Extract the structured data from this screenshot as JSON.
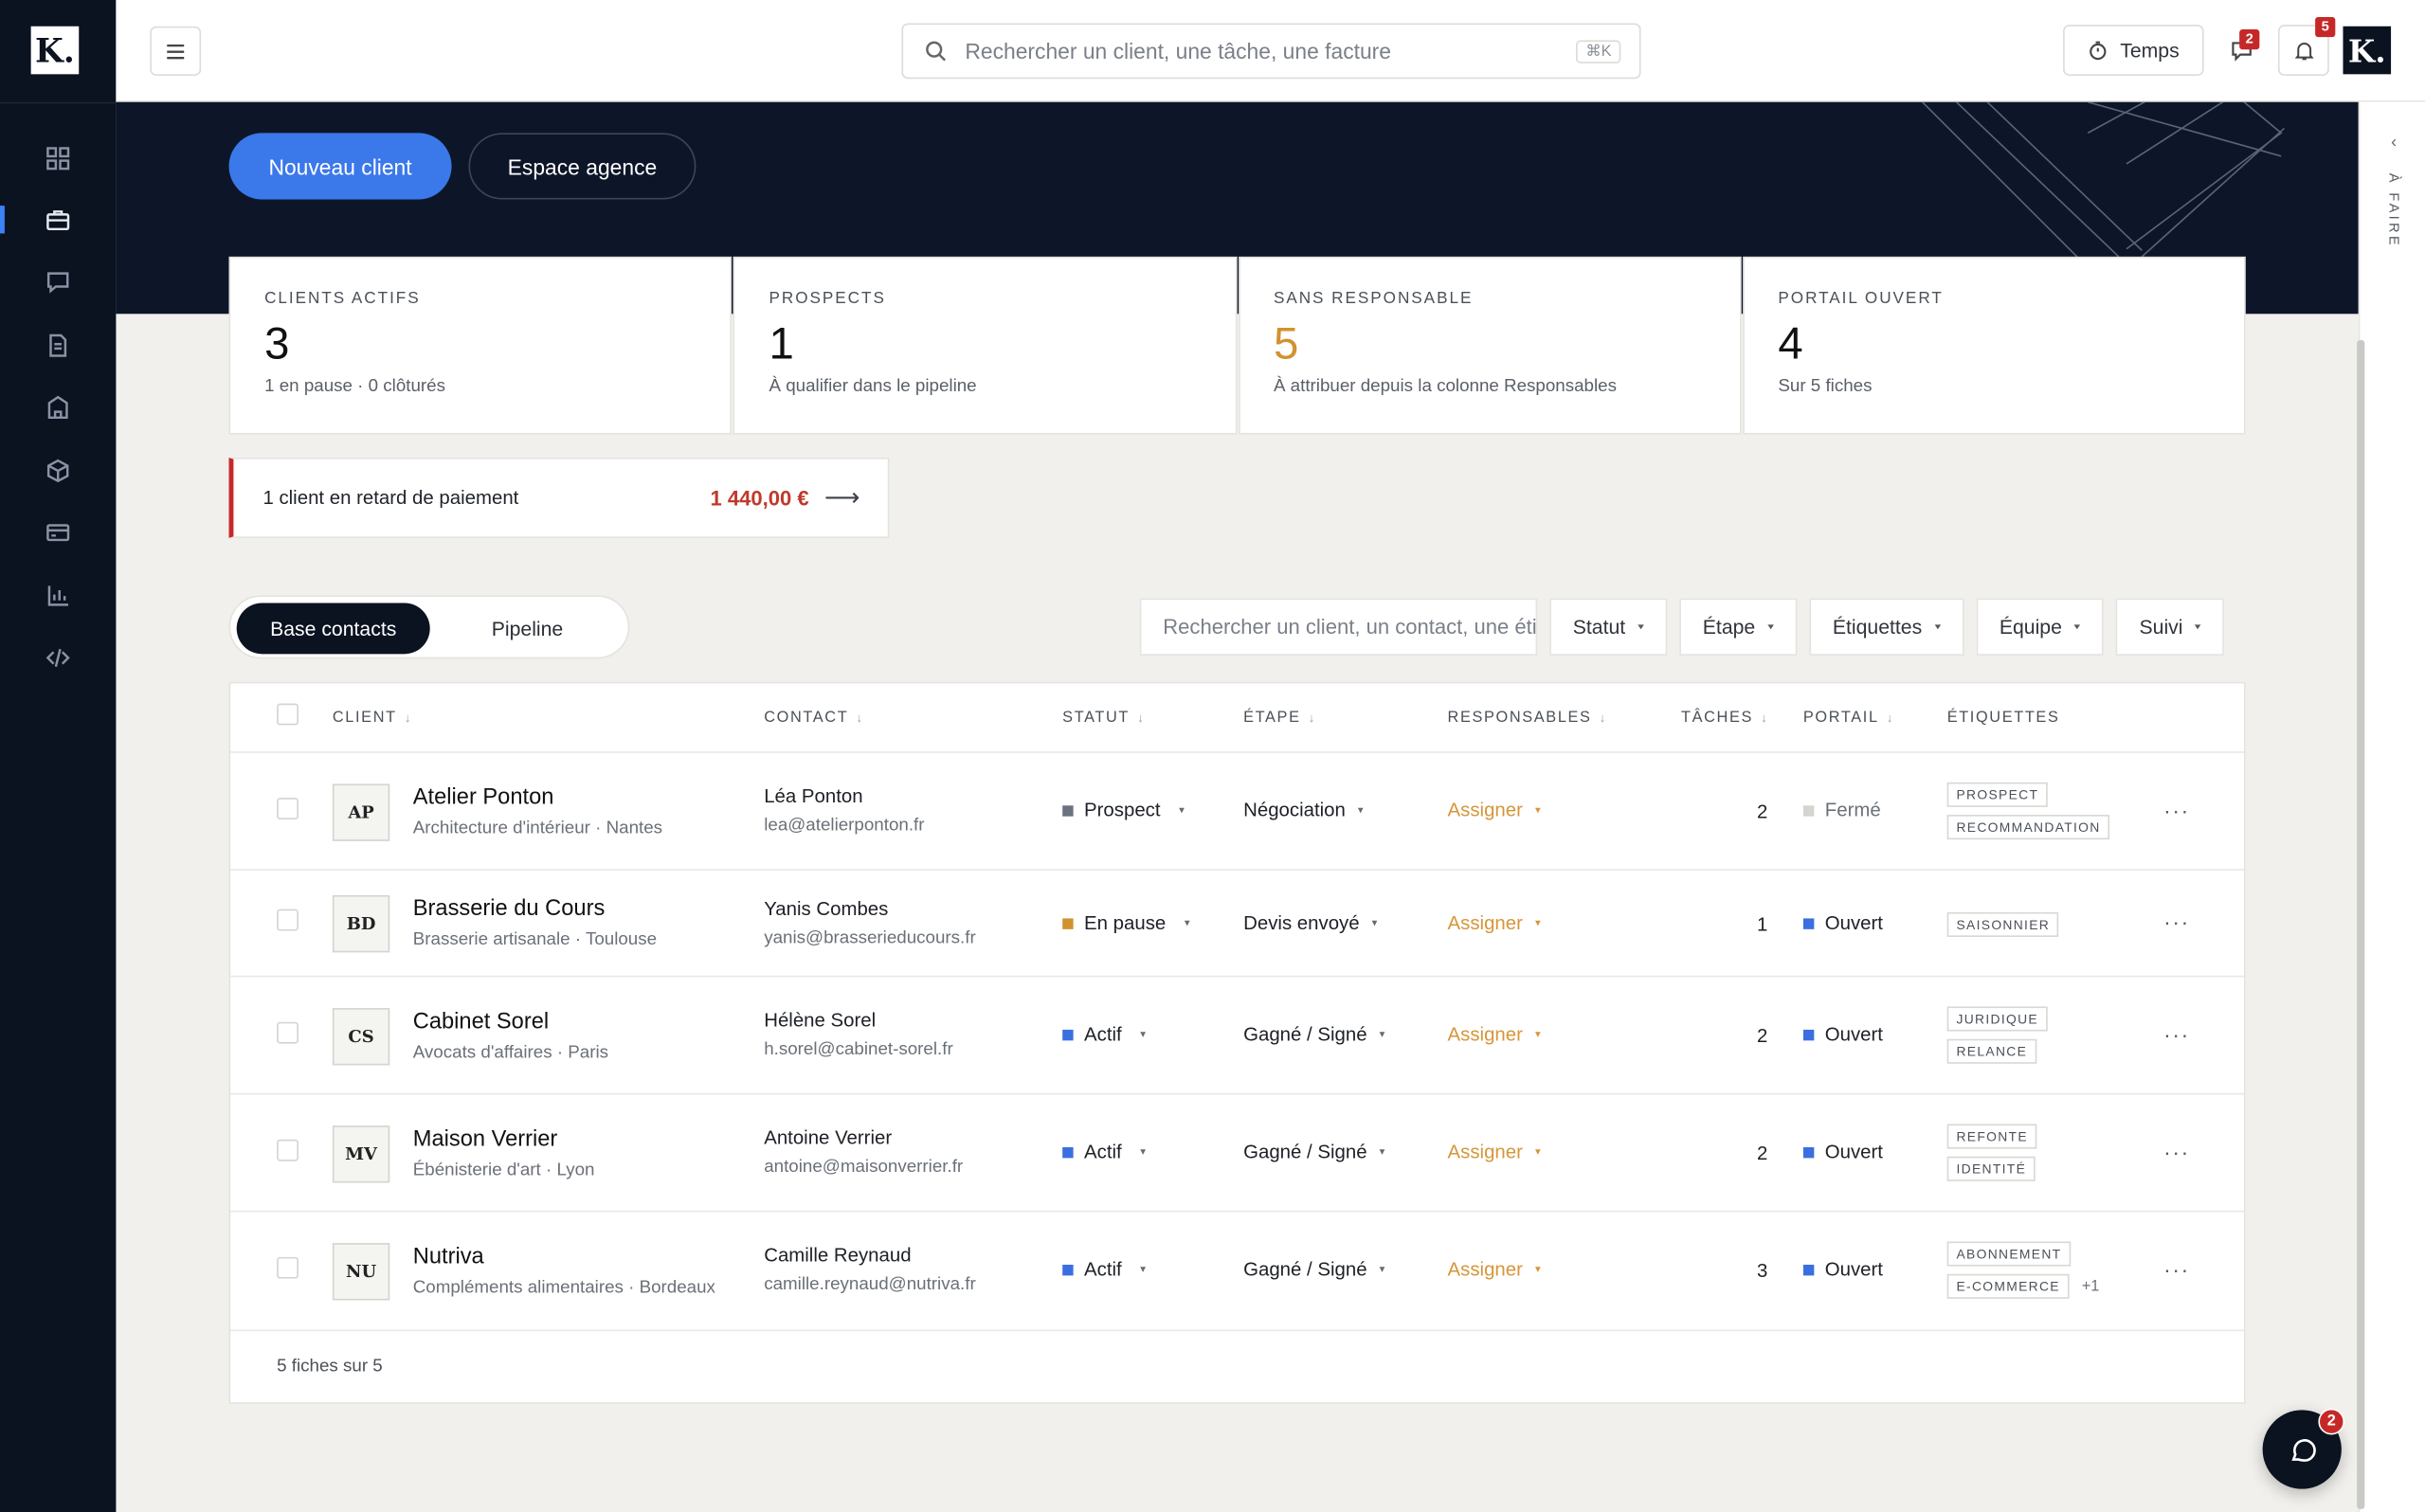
{
  "brand": {
    "logo_letter": "K."
  },
  "sidebar": {
    "items": [
      {
        "icon": "dashboard-grid-icon"
      },
      {
        "icon": "briefcase-icon",
        "active": true
      },
      {
        "icon": "chat-bubble-icon"
      },
      {
        "icon": "document-icon"
      },
      {
        "icon": "building-icon"
      },
      {
        "icon": "package-box-icon"
      },
      {
        "icon": "credit-card-icon"
      },
      {
        "icon": "bar-chart-icon"
      },
      {
        "icon": "code-icon"
      }
    ]
  },
  "topbar": {
    "search_placeholder": "Rechercher un client, une tâche, une facture",
    "search_shortcut": "⌘K",
    "time_button": "Temps",
    "messages_badge": "2",
    "notifications_badge": "5",
    "avatar_letter": "K."
  },
  "hero": {
    "new_client_button": "Nouveau client",
    "agency_button": "Espace agence"
  },
  "stats": [
    {
      "label": "CLIENTS ACTIFS",
      "value": "3",
      "sub": "1 en pause · 0 clôturés"
    },
    {
      "label": "PROSPECTS",
      "value": "1",
      "sub": "À qualifier dans le pipeline"
    },
    {
      "label": "SANS RESPONSABLE",
      "value": "5",
      "sub": "À attribuer depuis la colonne Responsables"
    },
    {
      "label": "PORTAIL OUVERT",
      "value": "4",
      "sub": "Sur 5 fiches"
    }
  ],
  "alert": {
    "text": "1 client en retard de paiement",
    "amount": "1 440,00 €",
    "arrow": "⟶"
  },
  "view_toggle": {
    "active": "Base contacts",
    "inactive": "Pipeline"
  },
  "filters": {
    "search_placeholder": "Rechercher un client, un contact, une étiquette",
    "buttons": [
      "Statut",
      "Étape",
      "Étiquettes",
      "Équipe",
      "Suivi"
    ]
  },
  "table": {
    "headers": {
      "client": "CLIENT",
      "contact": "CONTACT",
      "statut": "STATUT",
      "etape": "ÉTAPE",
      "responsables": "RESPONSABLES",
      "taches": "TÂCHES",
      "portail": "PORTAIL",
      "etiquettes": "ÉTIQUETTES"
    },
    "sort_glyph": "↓",
    "more_glyph": "···",
    "rows": [
      {
        "initials": "AP",
        "name": "Atelier Ponton",
        "sub": "Architecture d'intérieur · Nantes",
        "contact": "Léa Ponton",
        "email": "lea@atelierponton.fr",
        "statut": "Prospect",
        "statut_color": "#6b7280",
        "etape": "Négociation",
        "responsable": "Assigner",
        "taches": "2",
        "portail": "Fermé",
        "portail_color": "#d4d4d0",
        "tags": [
          "PROSPECT",
          "RECOMMANDATION"
        ],
        "extra_tags": ""
      },
      {
        "initials": "BD",
        "name": "Brasserie du Cours",
        "sub": "Brasserie artisanale · Toulouse",
        "contact": "Yanis Combes",
        "email": "yanis@brasserieducours.fr",
        "statut": "En pause",
        "statut_color": "#d19230",
        "etape": "Devis envoyé",
        "responsable": "Assigner",
        "taches": "1",
        "portail": "Ouvert",
        "portail_color": "#3b6fe0",
        "tags": [
          "SAISONNIER"
        ],
        "extra_tags": ""
      },
      {
        "initials": "CS",
        "name": "Cabinet Sorel",
        "sub": "Avocats d'affaires · Paris",
        "contact": "Hélène Sorel",
        "email": "h.sorel@cabinet-sorel.fr",
        "statut": "Actif",
        "statut_color": "#3b6fe0",
        "etape": "Gagné / Signé",
        "responsable": "Assigner",
        "taches": "2",
        "portail": "Ouvert",
        "portail_color": "#3b6fe0",
        "tags": [
          "JURIDIQUE",
          "RELANCE"
        ],
        "extra_tags": ""
      },
      {
        "initials": "MV",
        "name": "Maison Verrier",
        "sub": "Ébénisterie d'art · Lyon",
        "contact": "Antoine Verrier",
        "email": "antoine@maisonverrier.fr",
        "statut": "Actif",
        "statut_color": "#3b6fe0",
        "etape": "Gagné / Signé",
        "responsable": "Assigner",
        "taches": "2",
        "portail": "Ouvert",
        "portail_color": "#3b6fe0",
        "tags": [
          "REFONTE",
          "IDENTITÉ"
        ],
        "extra_tags": ""
      },
      {
        "initials": "NU",
        "name": "Nutriva",
        "sub": "Compléments alimentaires · Bordeaux",
        "contact": "Camille Reynaud",
        "email": "camille.reynaud@nutriva.fr",
        "statut": "Actif",
        "statut_color": "#3b6fe0",
        "etape": "Gagné / Signé",
        "responsable": "Assigner",
        "taches": "3",
        "portail": "Ouvert",
        "portail_color": "#3b6fe0",
        "tags": [
          "ABONNEMENT",
          "E-COMMERCE"
        ],
        "extra_tags": "+1"
      }
    ],
    "footer": "5 fiches sur 5"
  },
  "right_panel": {
    "label": "À FAIRE",
    "chevron": "‹"
  },
  "chat": {
    "badge": "2"
  }
}
